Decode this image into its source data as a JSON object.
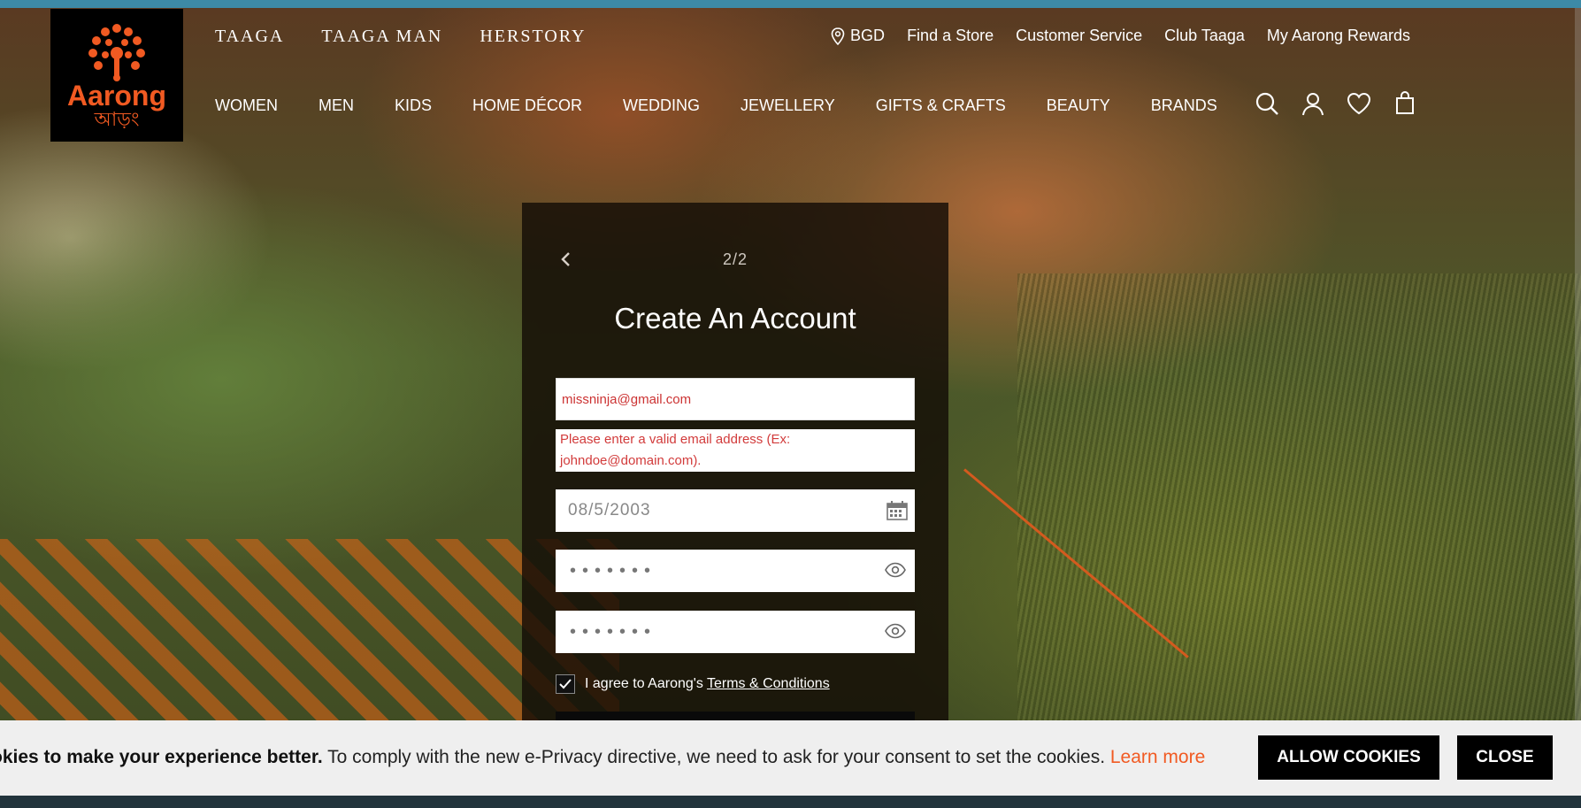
{
  "logo": {
    "name": "Aarong",
    "bangla": "আড়ং"
  },
  "subbrands": [
    "TAAGA",
    "TAAGA MAN",
    "HERSTORY"
  ],
  "utility": {
    "country": "BGD",
    "links": [
      "Find a Store",
      "Customer Service",
      "Club Taaga",
      "My Aarong Rewards"
    ]
  },
  "nav": [
    "WOMEN",
    "MEN",
    "KIDS",
    "HOME DÉCOR",
    "WEDDING",
    "JEWELLERY",
    "GIFTS & CRAFTS",
    "BEAUTY",
    "BRANDS"
  ],
  "icons": [
    "search-icon",
    "account-icon",
    "wishlist-icon",
    "cart-icon"
  ],
  "form": {
    "step": "2/2",
    "title": "Create An Account",
    "email_value": "missninja@gmail.com",
    "email_error": "Please enter a valid email address (Ex: johndoe@domain.com).",
    "dob_value": "08/5/2003",
    "password_mask": "•••••••",
    "confirm_mask": "•••••••",
    "agree_prefix": "I agree to Aarong's",
    "terms_link": "Terms & Conditions"
  },
  "cookie": {
    "bold": "okies to make your experience better.",
    "text": " To comply with the new e-Privacy directive, we need to ask for your consent to set the cookies. ",
    "learn_more": "Learn more",
    "allow_label": "ALLOW COOKIES",
    "close_label": "CLOSE"
  },
  "colors": {
    "brand_orange": "#f15a22",
    "error_red": "#d23b3b",
    "top_strip": "#3d8aa6"
  }
}
